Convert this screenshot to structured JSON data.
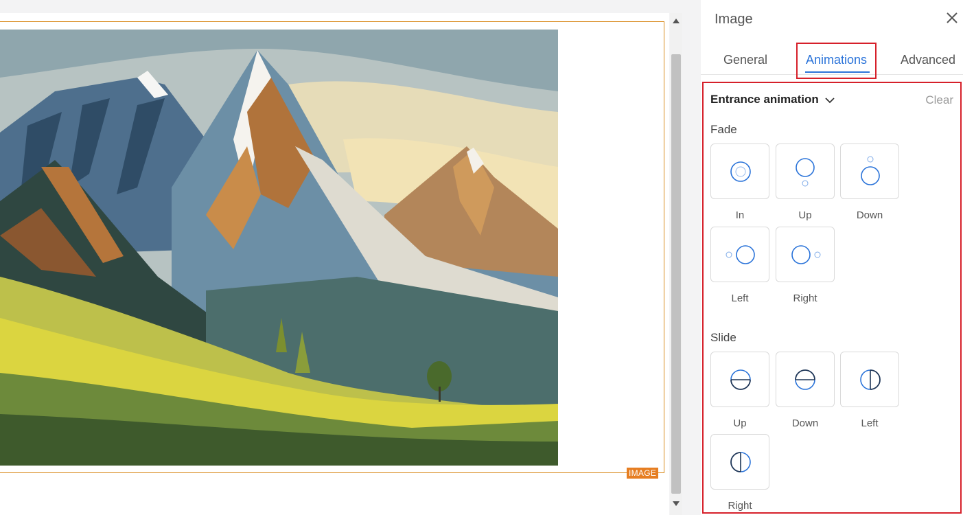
{
  "canvas": {
    "image_tag": "IMAGE"
  },
  "panel": {
    "title": "Image",
    "tabs": [
      "General",
      "Animations",
      "Advanced"
    ],
    "active_tab": "Animations",
    "entrance_label": "Entrance animation",
    "clear_label": "Clear",
    "groups": [
      {
        "title": "Fade",
        "items": [
          "In",
          "Up",
          "Down",
          "Left",
          "Right"
        ]
      },
      {
        "title": "Slide",
        "items": [
          "Up",
          "Down",
          "Left",
          "Right"
        ]
      }
    ]
  },
  "colors": {
    "accent": "#2a73d9",
    "highlight": "#d6202a",
    "tag": "#e67e22"
  }
}
